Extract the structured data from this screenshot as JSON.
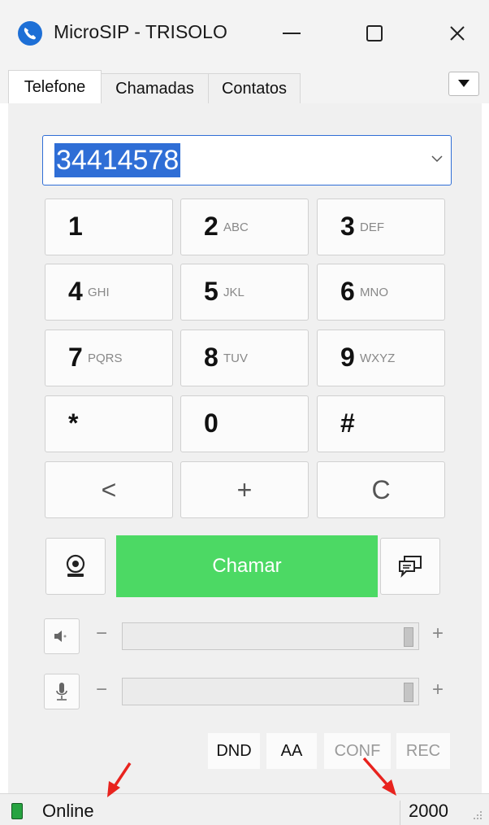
{
  "window": {
    "title": "MicroSIP - TRISOLO",
    "icon": "microsip-phone-icon",
    "controls": [
      "minimize-icon",
      "maximize-icon",
      "close-icon"
    ]
  },
  "tabs": [
    {
      "label": "Telefone",
      "active": true
    },
    {
      "label": "Chamadas",
      "active": false
    },
    {
      "label": "Contatos",
      "active": false
    }
  ],
  "dialer": {
    "number": "34414578",
    "keys": [
      {
        "digit": "1",
        "letters": ""
      },
      {
        "digit": "2",
        "letters": "ABC"
      },
      {
        "digit": "3",
        "letters": "DEF"
      },
      {
        "digit": "4",
        "letters": "GHI"
      },
      {
        "digit": "5",
        "letters": "JKL"
      },
      {
        "digit": "6",
        "letters": "MNO"
      },
      {
        "digit": "7",
        "letters": "PQRS"
      },
      {
        "digit": "8",
        "letters": "TUV"
      },
      {
        "digit": "9",
        "letters": "WXYZ"
      },
      {
        "digit": "*",
        "letters": ""
      },
      {
        "digit": "0",
        "letters": ""
      },
      {
        "digit": "#",
        "letters": ""
      }
    ],
    "controls": {
      "backspace": "<",
      "plus": "+",
      "clear": "C"
    },
    "call_label": "Chamar"
  },
  "audio": {
    "speaker_minus": "−",
    "speaker_plus": "+",
    "mic_minus": "−",
    "mic_plus": "+",
    "speaker_level": 1.0,
    "mic_level": 1.0
  },
  "options": [
    {
      "label": "DND",
      "enabled": true
    },
    {
      "label": "AA",
      "enabled": true
    },
    {
      "label": "CONF",
      "enabled": false
    },
    {
      "label": "REC",
      "enabled": false
    }
  ],
  "status": {
    "state": "Online",
    "extension": "2000"
  },
  "colors": {
    "call_button": "#4cd964",
    "selection": "#2f6ed6",
    "online_led": "#27a341",
    "annotation_arrow": "#e8231e"
  }
}
